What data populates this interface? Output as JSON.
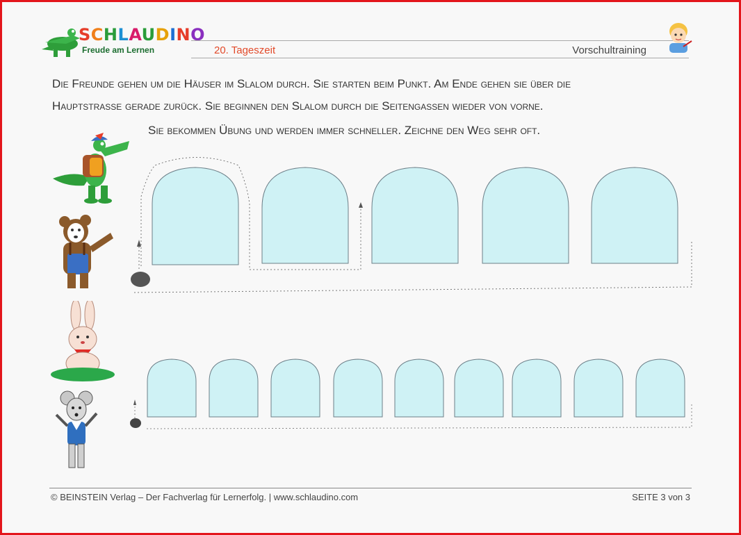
{
  "logo": {
    "title_letters": [
      "S",
      "C",
      "H",
      "L",
      "A",
      "U",
      "D",
      "I",
      "N",
      "O"
    ],
    "title_colors": [
      "#e63d2a",
      "#f07f1a",
      "#2a9c3a",
      "#1c8fd3",
      "#d81b6a",
      "#2a9c3a",
      "#e6a10a",
      "#1c6fd3",
      "#e63d2a",
      "#8a2fbf"
    ],
    "subtitle": "Freude am Lernen"
  },
  "header": {
    "topic": "20. Tageszeit",
    "category": "Vorschultraining"
  },
  "instructions": {
    "line1": "Die Freunde gehen um die Häuser im Slalom durch. Sie starten beim Punkt. Am Ende gehen sie über die",
    "line2": "Hauptstrasse gerade zurück. Sie beginnen den Slalom durch die Seitengassen wieder von vorne.",
    "line3": "Sie bekommen Übung und werden immer schneller. Zeichne den Weg sehr oft."
  },
  "exercise": {
    "row1_house_count": 5,
    "row2_house_count": 9,
    "house_fill": "#cff2f5",
    "house_stroke": "#6d7f88"
  },
  "footer": {
    "left": "© BEINSTEIN Verlag – Der Fachverlag für Lernerfolg.  |  www.schlaudino.com",
    "right": "SEITE 3 von 3"
  },
  "colors": {
    "frame": "#e3151b",
    "croc_green": "#2e9e3a",
    "bear_brown": "#8b5a2b",
    "jeans_blue": "#3a6fc4"
  }
}
